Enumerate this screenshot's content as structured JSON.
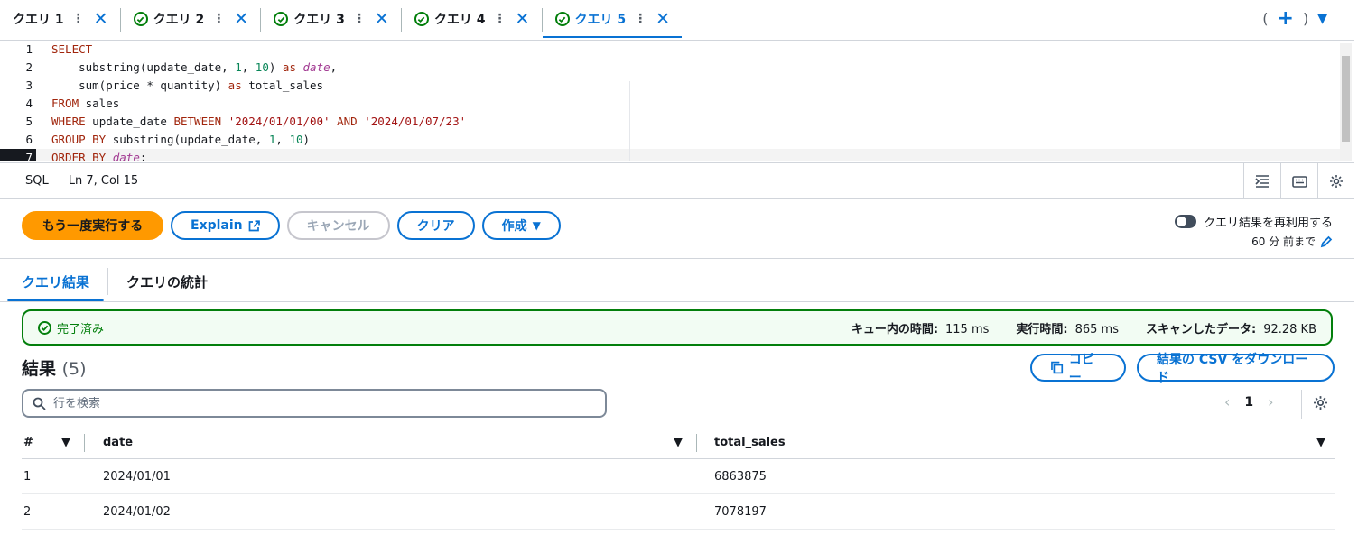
{
  "tabs": [
    {
      "label": "クエリ 1",
      "state": "none"
    },
    {
      "label": "クエリ 2",
      "state": "completed"
    },
    {
      "label": "クエリ 3",
      "state": "completed"
    },
    {
      "label": "クエリ 4",
      "state": "completed"
    },
    {
      "label": "クエリ 5",
      "state": "active"
    }
  ],
  "tab_actions": {
    "open_paren": "(",
    "plus": "+",
    "close_paren": ")",
    "caret": "▼"
  },
  "editor": {
    "lines": [
      {
        "n": "1",
        "tokens": [
          {
            "t": "SELECT",
            "c": "kw"
          }
        ]
      },
      {
        "n": "2",
        "tokens": [
          {
            "t": "    substring(update_date, ",
            "c": ""
          },
          {
            "t": "1",
            "c": "num"
          },
          {
            "t": ", ",
            "c": ""
          },
          {
            "t": "10",
            "c": "num"
          },
          {
            "t": ") ",
            "c": ""
          },
          {
            "t": "as",
            "c": "kw"
          },
          {
            "t": " ",
            "c": ""
          },
          {
            "t": "date",
            "c": "it"
          },
          {
            "t": ",",
            "c": ""
          }
        ]
      },
      {
        "n": "3",
        "tokens": [
          {
            "t": "    sum(price * quantity) ",
            "c": ""
          },
          {
            "t": "as",
            "c": "kw"
          },
          {
            "t": " total_sales",
            "c": ""
          }
        ]
      },
      {
        "n": "4",
        "tokens": [
          {
            "t": "FROM",
            "c": "kw"
          },
          {
            "t": " sales",
            "c": ""
          }
        ]
      },
      {
        "n": "5",
        "tokens": [
          {
            "t": "WHERE",
            "c": "kw"
          },
          {
            "t": " update_date ",
            "c": ""
          },
          {
            "t": "BETWEEN",
            "c": "kw"
          },
          {
            "t": " ",
            "c": ""
          },
          {
            "t": "'2024/01/01/00'",
            "c": "str"
          },
          {
            "t": " ",
            "c": ""
          },
          {
            "t": "AND",
            "c": "kw"
          },
          {
            "t": " ",
            "c": ""
          },
          {
            "t": "'2024/01/07/23'",
            "c": "str"
          }
        ]
      },
      {
        "n": "6",
        "tokens": [
          {
            "t": "GROUP BY",
            "c": "kw"
          },
          {
            "t": " substring(update_date, ",
            "c": ""
          },
          {
            "t": "1",
            "c": "num"
          },
          {
            "t": ", ",
            "c": ""
          },
          {
            "t": "10",
            "c": "num"
          },
          {
            "t": ")",
            "c": ""
          }
        ]
      },
      {
        "n": "7",
        "tokens": [
          {
            "t": "ORDER BY",
            "c": "kw"
          },
          {
            "t": " ",
            "c": ""
          },
          {
            "t": "date",
            "c": "it"
          },
          {
            "t": ";",
            "c": ""
          }
        ],
        "current": true
      }
    ]
  },
  "statusbar": {
    "language": "SQL",
    "position": "Ln 7, Col 15"
  },
  "actions": {
    "run_again": "もう一度実行する",
    "explain": "Explain",
    "cancel": "キャンセル",
    "clear": "クリア",
    "create": "作成"
  },
  "reuse": {
    "label": "クエリ結果を再利用する",
    "subtext": "60 分 前まで"
  },
  "result_tabs": {
    "results": "クエリ結果",
    "stats": "クエリの統計"
  },
  "alert": {
    "status": "完了済み",
    "queue_label": "キュー内の時間:",
    "queue_value": "115 ms",
    "exec_label": "実行時間:",
    "exec_value": "865 ms",
    "scan_label": "スキャンしたデータ:",
    "scan_value": "92.28 KB"
  },
  "results": {
    "title": "結果",
    "count": "(5)",
    "copy_label": "コピー",
    "csv_label": "結果の CSV をダウンロード",
    "search_placeholder": "行を検索",
    "page": "1"
  },
  "table": {
    "columns": [
      "#",
      "date",
      "total_sales"
    ],
    "rows": [
      [
        "1",
        "2024/01/01",
        "6863875"
      ],
      [
        "2",
        "2024/01/02",
        "7078197"
      ]
    ]
  }
}
